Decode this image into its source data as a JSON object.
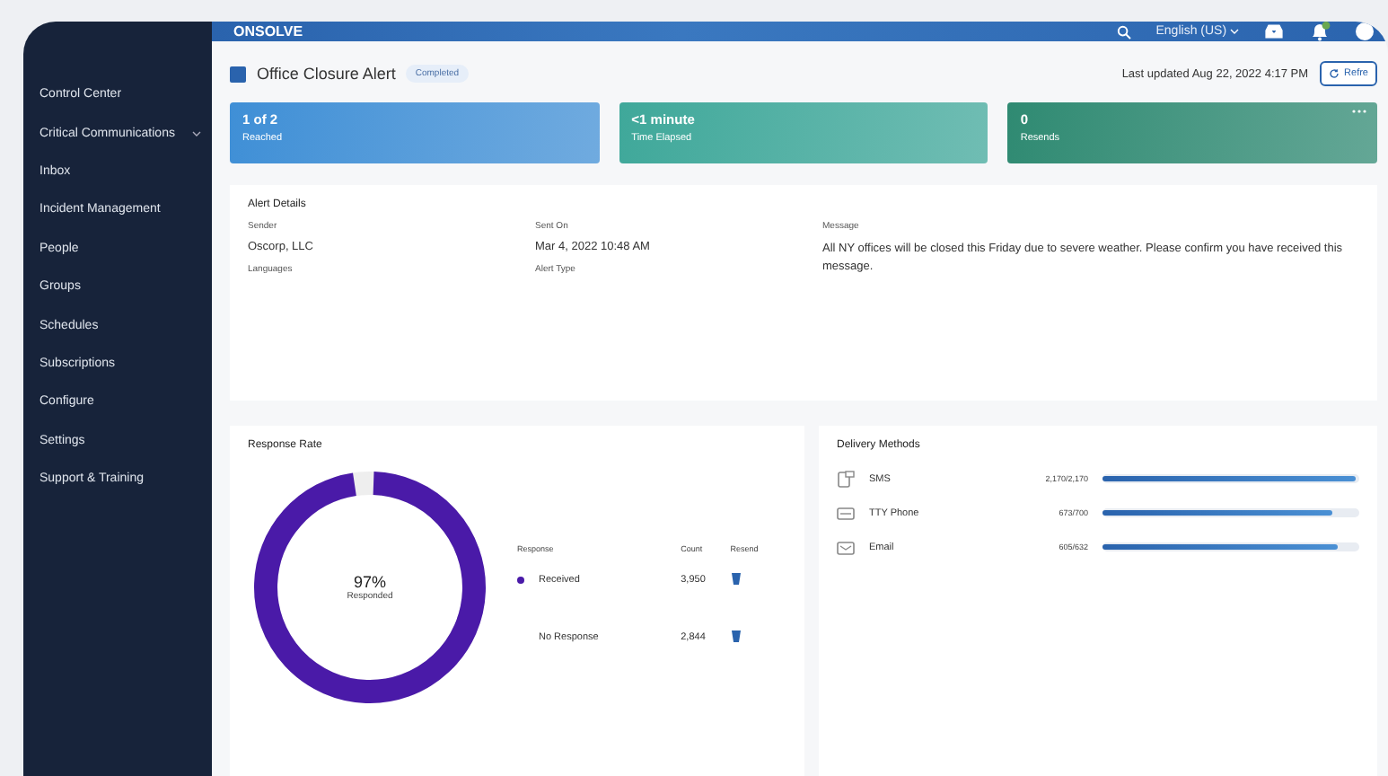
{
  "brand": "ONSOLVE",
  "topbar": {
    "language": "English (US)"
  },
  "sidebar": {
    "items": [
      {
        "label": "Control Center",
        "expandable": false
      },
      {
        "label": "Critical Communications",
        "expandable": true
      },
      {
        "label": "Inbox",
        "expandable": false
      },
      {
        "label": "Incident Management",
        "expandable": false
      },
      {
        "label": "People",
        "expandable": false
      },
      {
        "label": "Groups",
        "expandable": false
      },
      {
        "label": "Schedules",
        "expandable": false
      },
      {
        "label": "Subscriptions",
        "expandable": false
      },
      {
        "label": "Configure",
        "expandable": false
      },
      {
        "label": "Settings",
        "expandable": false
      },
      {
        "label": "Support & Training",
        "expandable": false
      }
    ]
  },
  "header": {
    "title": "Office Closure Alert",
    "status": "Completed",
    "last_updated": "Last updated Aug 22, 2022 4:17 PM",
    "refresh": "Refre"
  },
  "stats": [
    {
      "value": "1 of 2",
      "label": "Reached",
      "color": "#3f8fd6"
    },
    {
      "value": "<1 minute",
      "label": "Time Elapsed",
      "color": "#3fa89a"
    },
    {
      "value": "0",
      "label": "Resends",
      "color": "#2f8a72"
    }
  ],
  "details": {
    "title": "Alert Details",
    "fields": [
      {
        "label": "Sender",
        "value": "Oscorp, LLC"
      },
      {
        "label": "Sent On",
        "value": "Mar 4, 2022 10:48 AM"
      },
      {
        "label": "Languages"
      },
      {
        "label": "Alert Type"
      }
    ],
    "message_label": "Message",
    "message": "All NY offices will be closed this Friday due to severe weather. Please confirm you have received this message."
  },
  "response": {
    "title": "Response Rate",
    "percent": "97%",
    "caption": "Responded",
    "level": 0.97,
    "columns": [
      "Response",
      "Count",
      "Resend"
    ],
    "rows": [
      {
        "label": "Received",
        "count": "3,950",
        "color": "#4a1aa8"
      },
      {
        "label": "No Response",
        "count": "2,844"
      }
    ]
  },
  "delivery": {
    "title": "Delivery Methods",
    "methods": [
      {
        "kind": "sms",
        "label": "SMS",
        "reading": "2,170/2,170",
        "level": 1
      },
      {
        "kind": "phone",
        "label": "TTY Phone",
        "reading": "673/700",
        "level": 0.91
      },
      {
        "kind": "email",
        "label": "Email",
        "reading": "605/632",
        "level": 0.93
      }
    ]
  }
}
